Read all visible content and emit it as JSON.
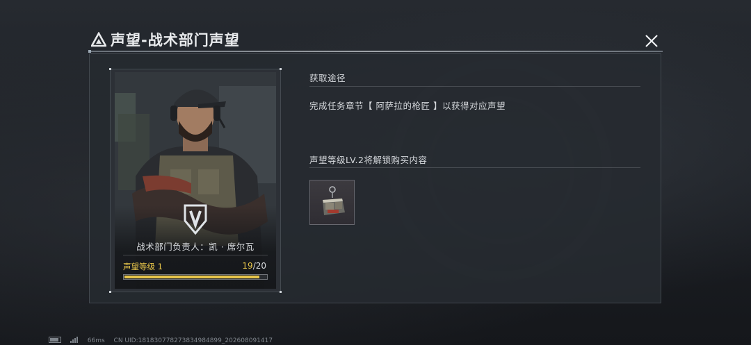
{
  "title": "声望-战术部门声望",
  "close_icon": "close-icon",
  "card": {
    "manager_label": "战术部门负责人：凯 · 席尔瓦",
    "level_label": "声望等级 1",
    "progress_current": "19",
    "progress_total": "/20",
    "progress_fraction": 0.95,
    "accent_color": "#e8c64a"
  },
  "acquire": {
    "heading": "获取途径",
    "description": "完成任务章节【 阿萨拉的枪匠 】以获得对应声望"
  },
  "unlock": {
    "heading": "声望等级LV.2将解锁购买内容",
    "items": [
      {
        "icon": "keychain-bag-icon"
      }
    ]
  },
  "footer": {
    "ping": "66ms",
    "uid": "CN UID:1818307782738349848​99_202608091417"
  }
}
